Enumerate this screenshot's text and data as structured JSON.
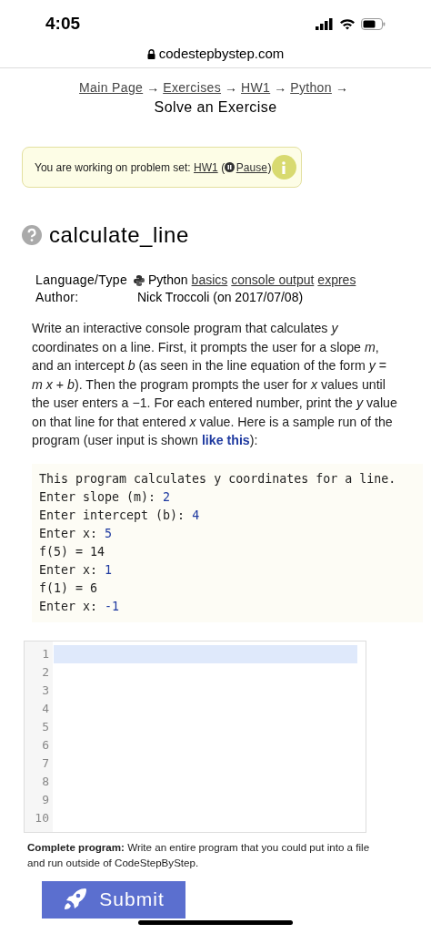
{
  "status_bar": {
    "time": "4:05"
  },
  "address_bar": {
    "url": "codestepbystep.com"
  },
  "breadcrumb": [
    {
      "label": "Main Page",
      "link": true
    },
    {
      "separator": "→",
      "label": "Exercises",
      "link": true
    },
    {
      "separator": "→",
      "label": "HW1",
      "link": true
    },
    {
      "separator": "→",
      "label": "Python",
      "link": true
    },
    {
      "separator": "→",
      "label": "Solve an Exercise",
      "link": false
    }
  ],
  "notice": {
    "text": "You are working on problem set: ",
    "set_link": "HW1",
    "open": "(",
    "pause_link": "Pause",
    "close": ")"
  },
  "problem": {
    "title": "calculate_line",
    "meta": [
      {
        "label": "Language/Type",
        "value": "Python",
        "tags": [
          "basics",
          "console output",
          "expres"
        ]
      },
      {
        "label": "Author:",
        "value": "Nick Troccoli (on 2017/07/08)"
      }
    ],
    "description": {
      "before": "Write an interactive console program that calculates *y* coordinates on a line. First, it prompts the user for a slope *m*, and an intercept *b* (as seen in the line equation of the form *y* = *m x* + *b*). Then the program prompts the user for *x* values until the user enters a −1. For each entered number, print the *y* value on that line for that entered *x* value. Here is a sample run of the program (user input is shown ",
      "sample": "like this",
      "after": "):"
    },
    "sample_run": [
      {
        "output": "This program calculates y coordinates for a line."
      },
      {
        "output": "Enter slope (m): ",
        "input": "2"
      },
      {
        "output": "Enter intercept (b): ",
        "input": "4"
      },
      {
        "output": "Enter x: ",
        "input": "5"
      },
      {
        "output": "f(5) = 14"
      },
      {
        "output": "Enter x: ",
        "input": "1"
      },
      {
        "output": "f(1) = 6"
      },
      {
        "output": "Enter x: ",
        "input": "-1"
      }
    ]
  },
  "editor": {
    "lines": [
      {
        "number": "1",
        "active": true
      },
      {
        "number": "2",
        "active": false
      },
      {
        "number": "3",
        "active": false
      },
      {
        "number": "4",
        "active": false
      },
      {
        "number": "5",
        "active": false
      },
      {
        "number": "6",
        "active": false
      },
      {
        "number": "7",
        "active": false
      },
      {
        "number": "8",
        "active": false
      },
      {
        "number": "9",
        "active": false
      },
      {
        "number": "10",
        "active": false
      }
    ]
  },
  "note": "**Complete program:** Write an entire program that you could put into a file and run outside of CodeStepByStep.",
  "submit": {
    "label": "Submit"
  }
}
